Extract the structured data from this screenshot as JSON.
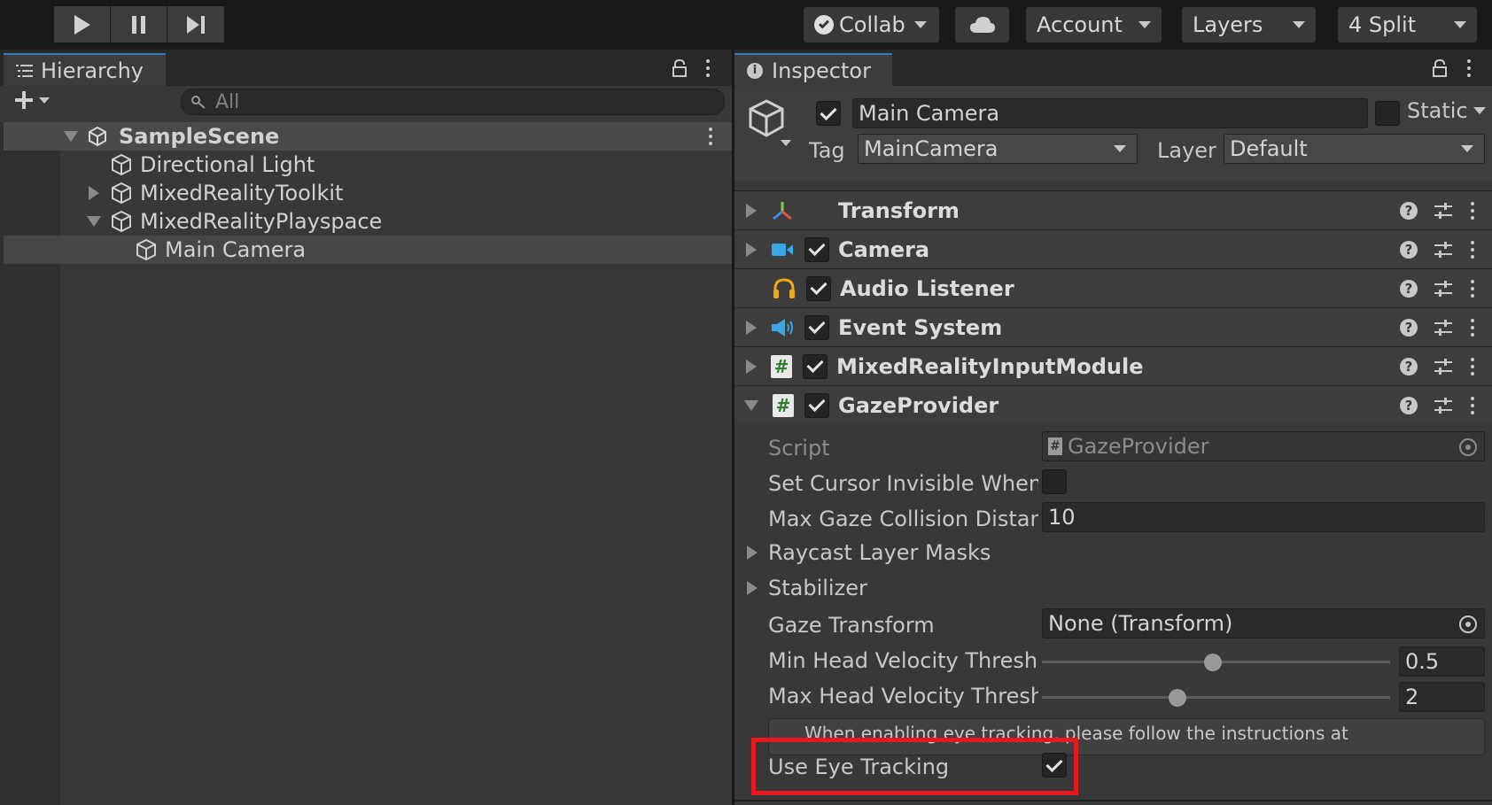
{
  "toolbar": {
    "collab_label": "Collab",
    "account_label": "Account",
    "layers_label": "Layers",
    "layout_label": "4 Split"
  },
  "hierarchy": {
    "tab_label": "Hierarchy",
    "search_placeholder": "All",
    "scene_name": "SampleScene",
    "items": [
      {
        "label": "Directional Light"
      },
      {
        "label": "MixedRealityToolkit"
      },
      {
        "label": "MixedRealityPlayspace"
      },
      {
        "label": "Main Camera"
      }
    ]
  },
  "inspector": {
    "tab_label": "Inspector",
    "object_name": "Main Camera",
    "static_label": "Static",
    "tag_label": "Tag",
    "tag_value": "MainCamera",
    "layer_label": "Layer",
    "layer_value": "Default",
    "components": [
      {
        "name": "Transform",
        "icon": "transform-icon"
      },
      {
        "name": "Camera",
        "icon": "camera-icon",
        "enabled": true
      },
      {
        "name": "Audio Listener",
        "icon": "headphones-icon",
        "enabled": true
      },
      {
        "name": "Event System",
        "icon": "speaker-icon",
        "enabled": true
      },
      {
        "name": "MixedRealityInputModule",
        "icon": "script-icon",
        "enabled": true
      },
      {
        "name": "GazeProvider",
        "icon": "script-icon",
        "enabled": true
      }
    ],
    "gaze": {
      "script_label": "Script",
      "script_value": "GazeProvider",
      "cursor_label": "Set Cursor Invisible When F",
      "cursor_checked": false,
      "max_dist_label": "Max Gaze Collision Distanc",
      "max_dist_value": "10",
      "raycast_label": "Raycast Layer Masks",
      "stabilizer_label": "Stabilizer",
      "gaze_transform_label": "Gaze Transform",
      "gaze_transform_value": "None (Transform)",
      "min_vel_label": "Min Head Velocity Thresho",
      "min_vel_value": "0.5",
      "min_vel_fraction": 0.49,
      "max_vel_label": "Max Head Velocity Threshc",
      "max_vel_value": "2",
      "max_vel_fraction": 0.39,
      "help_text": "When enabling eye tracking, please follow the instructions at",
      "eye_tracking_label": "Use Eye Tracking",
      "eye_tracking_checked": true
    }
  },
  "colors": {
    "highlight": "#e8191e",
    "tab_accent": "#3a79bb"
  }
}
